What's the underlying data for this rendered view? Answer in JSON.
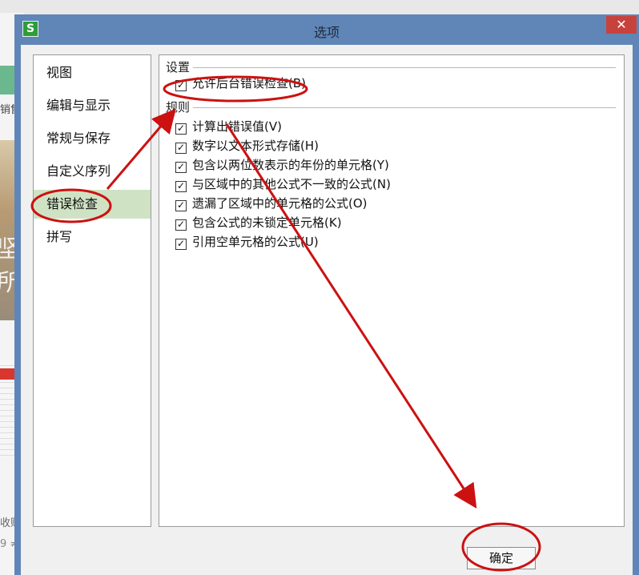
{
  "background": {
    "fragment_1": "销售",
    "big_1": "坚",
    "big_2": "所",
    "fragment_2": "收购",
    "fragment_3": "9 ≠"
  },
  "window": {
    "title": "选项",
    "app_icon": "S",
    "close_icon": "✕"
  },
  "sidebar": {
    "items": [
      {
        "label": "视图"
      },
      {
        "label": "编辑与显示"
      },
      {
        "label": "常规与保存"
      },
      {
        "label": "自定义序列"
      },
      {
        "label": "错误检查"
      },
      {
        "label": "拼写"
      }
    ],
    "selected": "错误检查"
  },
  "settings_group": {
    "label": "设置",
    "items": [
      {
        "label": "允许后台错误检查(B)",
        "checked": true
      }
    ]
  },
  "rules_group": {
    "label": "规则",
    "items": [
      {
        "label": "计算出错误值(V)",
        "checked": true
      },
      {
        "label": "数字以文本形式存储(H)",
        "checked": true
      },
      {
        "label": "包含以两位数表示的年份的单元格(Y)",
        "checked": true
      },
      {
        "label": "与区域中的其他公式不一致的公式(N)",
        "checked": true
      },
      {
        "label": "遗漏了区域中的单元格的公式(O)",
        "checked": true
      },
      {
        "label": "包含公式的未锁定单元格(K)",
        "checked": true
      },
      {
        "label": "引用空单元格的公式(U)",
        "checked": true
      }
    ]
  },
  "footer": {
    "ok_label": "确定"
  },
  "annotation": {
    "color": "#cc1111"
  }
}
